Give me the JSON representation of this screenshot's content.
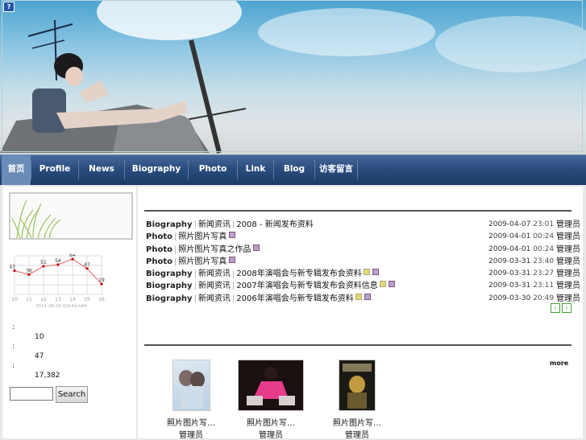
{
  "header": {
    "corner_icon": "?"
  },
  "nav": {
    "items": [
      "首页",
      "Profile",
      "News",
      "Biography",
      "Photo",
      "Link",
      "Blog",
      "访客留言"
    ]
  },
  "sidebar": {
    "chart_data": {
      "type": "line",
      "x": [
        "10",
        "11",
        "12",
        "13",
        "14",
        "15",
        "16"
      ],
      "values": [
        43,
        36,
        51,
        54,
        64,
        47,
        19
      ],
      "xlabel": "2011-06-16 01h41m44"
    },
    "stats": [
      {
        "label": ":",
        "value": "10"
      },
      {
        "label": ":",
        "value": "47"
      },
      {
        "label": ":",
        "value": "17,382"
      }
    ],
    "search_button": "Search"
  },
  "news": [
    {
      "category": "Biography",
      "sub": "新闻资讯",
      "title": "2008 - 新闻发布资料",
      "date": "2009-04-07",
      "time": "23:01",
      "author": "管理员",
      "tags": 0
    },
    {
      "category": "Photo",
      "sub": "照片图片写真",
      "title": "",
      "date": "2009-04-01",
      "time": "00:24",
      "author": "管理员",
      "tags": 1
    },
    {
      "category": "Photo",
      "sub": "照片图片写真之作品",
      "title": "",
      "date": "2009-04-01",
      "time": "00:24",
      "author": "管理员",
      "tags": 1
    },
    {
      "category": "Photo",
      "sub": "照片图片写真",
      "title": "",
      "date": "2009-03-31",
      "time": "23:40",
      "author": "管理员",
      "tags": 1
    },
    {
      "category": "Biography",
      "sub": "新闻资讯",
      "title": "2008年演唱会与新专辑发布会资料",
      "date": "2009-03-31",
      "time": "23:27",
      "author": "管理员",
      "tags": 2
    },
    {
      "category": "Biography",
      "sub": "新闻资讯",
      "title": "2007年演唱会与新专辑发布会资料信息",
      "date": "2009-03-31",
      "time": "23:11",
      "author": "管理员",
      "tags": 2
    },
    {
      "category": "Biography",
      "sub": "新闻资讯",
      "title": "2006年演唱会与新专辑发布资料",
      "date": "2009-03-30",
      "time": "20:49",
      "author": "管理员",
      "tags": 2
    }
  ],
  "pager": {
    "prev": "‹",
    "next": "›"
  },
  "gallery": {
    "more": "more",
    "items": [
      {
        "title": "照片图片写…",
        "author": "管理员"
      },
      {
        "title": "照片图片写…",
        "author": "管理员"
      },
      {
        "title": "照片图片写…",
        "author": "管理员"
      }
    ]
  }
}
